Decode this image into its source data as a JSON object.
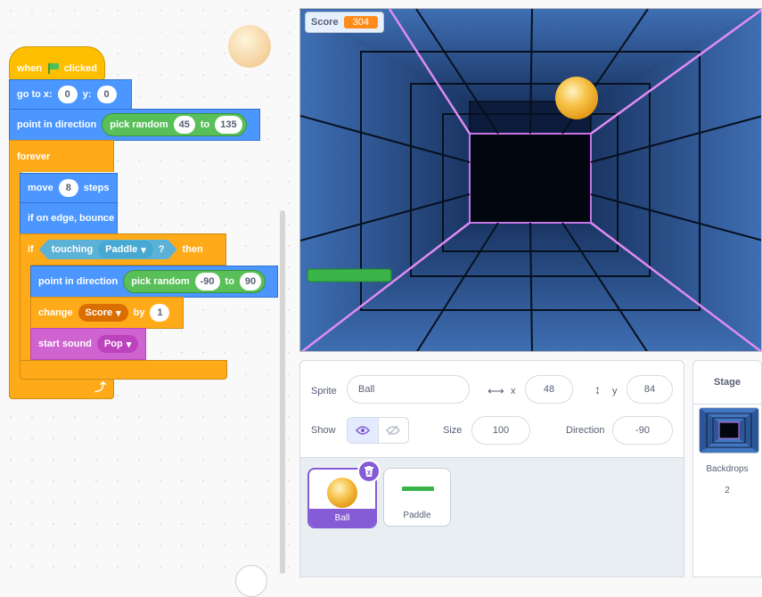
{
  "code": {
    "hat": {
      "when": "when",
      "clicked": "clicked"
    },
    "goto": {
      "label": "go to x:",
      "x": "0",
      "ylabel": "y:",
      "y": "0"
    },
    "point1": {
      "label": "point in direction",
      "pick": "pick random",
      "from": "45",
      "to_label": "to",
      "to": "135"
    },
    "forever": "forever",
    "move": {
      "label": "move",
      "value": "8",
      "unit": "steps"
    },
    "bounce": "if on edge, bounce",
    "if_block": {
      "if": "if",
      "touching": "touching",
      "target": "Paddle",
      "question": "?",
      "then": "then"
    },
    "point2": {
      "label": "point in direction",
      "pick": "pick random",
      "from": "-90",
      "to_label": "to",
      "to": "90"
    },
    "change": {
      "label": "change",
      "var": "Score",
      "by": "by",
      "value": "1"
    },
    "sound": {
      "label": "start sound",
      "value": "Pop"
    }
  },
  "stage": {
    "monitor_label": "Score",
    "monitor_value": "304"
  },
  "sprite_info": {
    "sprite_label": "Sprite",
    "sprite_name": "Ball",
    "x_label": "x",
    "x": "48",
    "y_label": "y",
    "y": "84",
    "show_label": "Show",
    "size_label": "Size",
    "size": "100",
    "direction_label": "Direction",
    "direction": "-90"
  },
  "sprites": [
    {
      "name": "Ball"
    },
    {
      "name": "Paddle"
    }
  ],
  "stage_pane": {
    "title": "Stage",
    "backdrops_label": "Backdrops",
    "backdrops_count": "2"
  },
  "colors": {
    "motion": "#4c97ff",
    "control": "#ffab19",
    "events": "#ffbf00",
    "operators": "#59c059",
    "sensing": "#5cb1d6",
    "variables": "#ff8c1a",
    "sound": "#cf63cf",
    "selected": "#855cd6"
  }
}
